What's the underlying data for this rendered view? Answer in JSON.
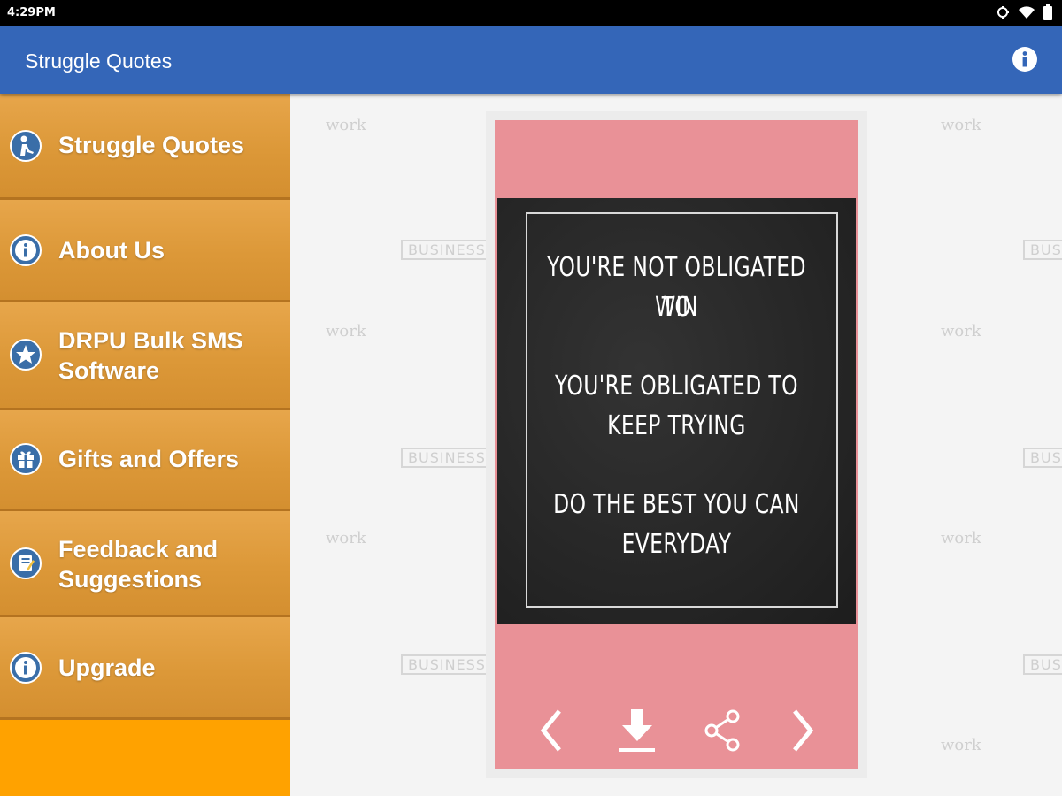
{
  "status_bar": {
    "time": "4:29PM"
  },
  "app_bar": {
    "title": "Struggle Quotes"
  },
  "drawer": {
    "items": [
      {
        "label_lines": [
          "Struggle Quotes"
        ],
        "icon": "person-icon"
      },
      {
        "label_lines": [
          "About Us"
        ],
        "icon": "info-icon"
      },
      {
        "label_lines": [
          "DRPU Bulk SMS",
          "Software"
        ],
        "icon": "star-icon"
      },
      {
        "label_lines": [
          "Gifts and Offers"
        ],
        "icon": "gift-icon"
      },
      {
        "label_lines": [
          "Feedback and",
          "Suggestions"
        ],
        "icon": "feedback-icon"
      },
      {
        "label_lines": [
          "Upgrade"
        ],
        "icon": "info-icon"
      }
    ]
  },
  "background": {
    "doodle_work": "work",
    "doodle_business": "BUSINESS"
  },
  "quote": {
    "lines": [
      "YOU'RE NOT OBLIGATED TO",
      "WIN",
      "YOU'RE OBLIGATED TO",
      "KEEP TRYING",
      "DO THE BEST YOU CAN",
      "EVERYDAY"
    ]
  },
  "controls": [
    "previous-icon",
    "download-icon",
    "share-icon",
    "next-icon"
  ],
  "colors": {
    "app_bar": "#3466b8",
    "drawer": "#ffa200",
    "card": "#e99197"
  }
}
